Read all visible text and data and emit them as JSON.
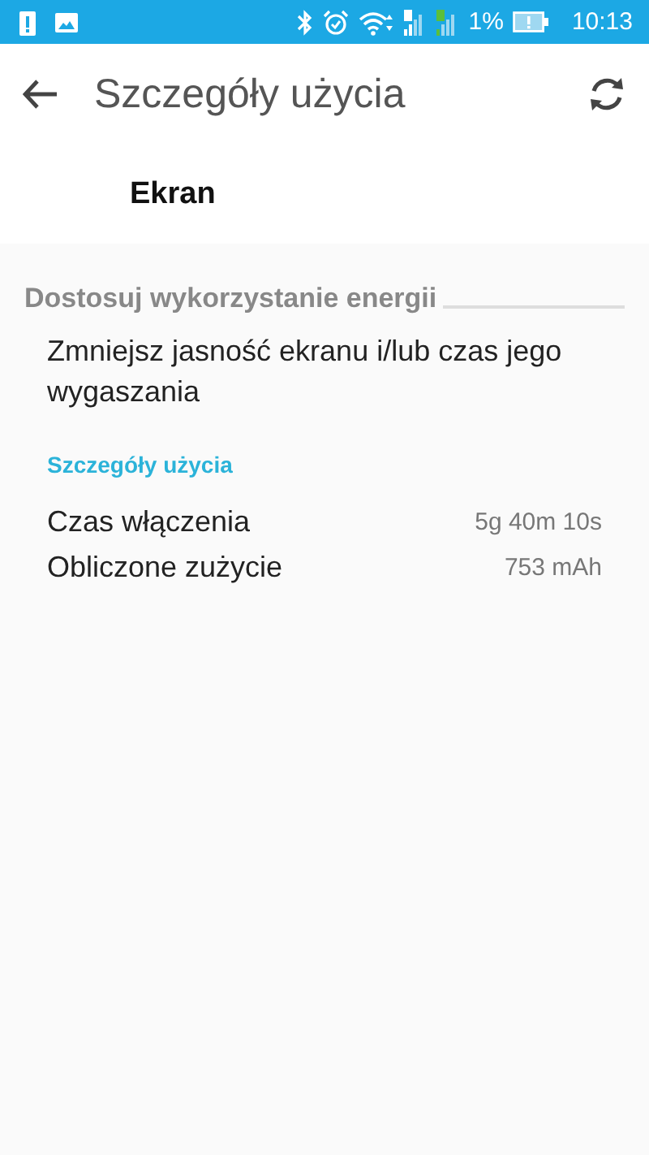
{
  "status_bar": {
    "battery_percent": "1%",
    "time": "10:13"
  },
  "toolbar": {
    "title": "Szczegóły użycia"
  },
  "app": {
    "name": "Ekran"
  },
  "section": {
    "title": "Dostosuj wykorzystanie energii",
    "tip": "Zmniejsz jasność ekranu i/lub czas jego wygaszania"
  },
  "details": {
    "title": "Szczegóły użycia",
    "rows": [
      {
        "label": "Czas włączenia",
        "value": "5g 40m 10s"
      },
      {
        "label": "Obliczone zużycie",
        "value": "753 mAh"
      }
    ]
  }
}
